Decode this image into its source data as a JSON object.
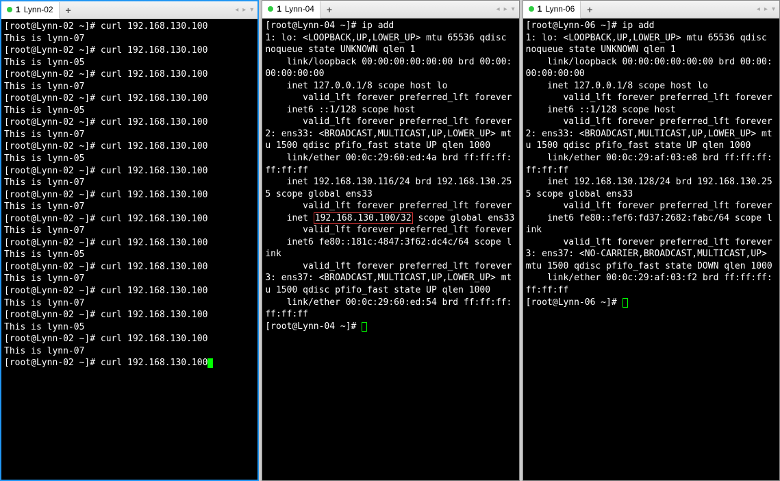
{
  "panes": [
    {
      "tab_number": "1",
      "tab_name": "Lynn-02",
      "active": true,
      "prompt_host": "Lynn-02",
      "curl_target": "192.168.130.100",
      "curl_responses": [
        "This is lynn-07",
        "This is lynn-05",
        "This is lynn-07",
        "This is lynn-05",
        "This is lynn-07",
        "This is lynn-05",
        "This is lynn-07",
        "This is lynn-07",
        "This is lynn-07",
        "This is lynn-05",
        "This is lynn-07",
        "This is lynn-07",
        "This is lynn-05",
        "This is lynn-07"
      ],
      "last_command": "curl 192.168.130.100",
      "cursor_style": "block"
    },
    {
      "tab_number": "1",
      "tab_name": "Lynn-04",
      "active": false,
      "prompt_host": "Lynn-04",
      "command": "ip add",
      "highlight_text": "192.168.130.100/32",
      "lo": {
        "header": "1: lo: <LOOPBACK,UP,LOWER_UP> mtu 65536 qdisc noqueue state UNKNOWN qlen 1",
        "link": "    link/loopback 00:00:00:00:00:00 brd 00:00:00:00:00:00",
        "inet": "    inet 127.0.0.1/8 scope host lo",
        "valid": "       valid_lft forever preferred_lft forever",
        "inet6": "    inet6 ::1/128 scope host",
        "valid6": "       valid_lft forever preferred_lft forever"
      },
      "ens33": {
        "header": "2: ens33: <BROADCAST,MULTICAST,UP,LOWER_UP> mtu 1500 qdisc pfifo_fast state UP qlen 1000",
        "link": "    link/ether 00:0c:29:60:ed:4a brd ff:ff:ff:ff:ff:ff",
        "inet": "    inet 192.168.130.116/24 brd 192.168.130.255 scope global ens33",
        "valid": "       valid_lft forever preferred_lft forever",
        "vip_pre": "    inet ",
        "vip_post": " scope global ens33",
        "vip_valid": "       valid_lft forever preferred_lft forever",
        "inet6": "    inet6 fe80::181c:4847:3f62:dc4c/64 scope link",
        "valid6": "       valid_lft forever preferred_lft forever"
      },
      "ens37": {
        "header": "3: ens37: <BROADCAST,MULTICAST,UP,LOWER_UP> mtu 1500 qdisc pfifo_fast state UP qlen 1000",
        "link": "    link/ether 00:0c:29:60:ed:54 brd ff:ff:ff:ff:ff:ff"
      },
      "final_prompt": "[root@Lynn-04 ~]# ",
      "cursor_style": "outline"
    },
    {
      "tab_number": "1",
      "tab_name": "Lynn-06",
      "active": false,
      "prompt_host": "Lynn-06",
      "command": "ip add",
      "lo": {
        "header": "1: lo: <LOOPBACK,UP,LOWER_UP> mtu 65536 qdisc noqueue state UNKNOWN qlen 1",
        "link": "    link/loopback 00:00:00:00:00:00 brd 00:00:00:00:00:00",
        "inet": "    inet 127.0.0.1/8 scope host lo",
        "valid": "       valid_lft forever preferred_lft forever",
        "inet6": "    inet6 ::1/128 scope host",
        "valid6": "       valid_lft forever preferred_lft forever"
      },
      "ens33": {
        "header": "2: ens33: <BROADCAST,MULTICAST,UP,LOWER_UP> mtu 1500 qdisc pfifo_fast state UP qlen 1000",
        "link": "    link/ether 00:0c:29:af:03:e8 brd ff:ff:ff:ff:ff:ff",
        "inet": "    inet 192.168.130.128/24 brd 192.168.130.255 scope global ens33",
        "valid": "       valid_lft forever preferred_lft forever",
        "inet6": "    inet6 fe80::fef6:fd37:2682:fabc/64 scope link",
        "valid6": "       valid_lft forever preferred_lft forever"
      },
      "ens37": {
        "header": "3: ens37: <NO-CARRIER,BROADCAST,MULTICAST,UP> mtu 1500 qdisc pfifo_fast state DOWN qlen 1000",
        "link": "    link/ether 00:0c:29:af:03:f2 brd ff:ff:ff:ff:ff:ff"
      },
      "final_prompt": "[root@Lynn-06 ~]# ",
      "cursor_style": "outline"
    }
  ]
}
